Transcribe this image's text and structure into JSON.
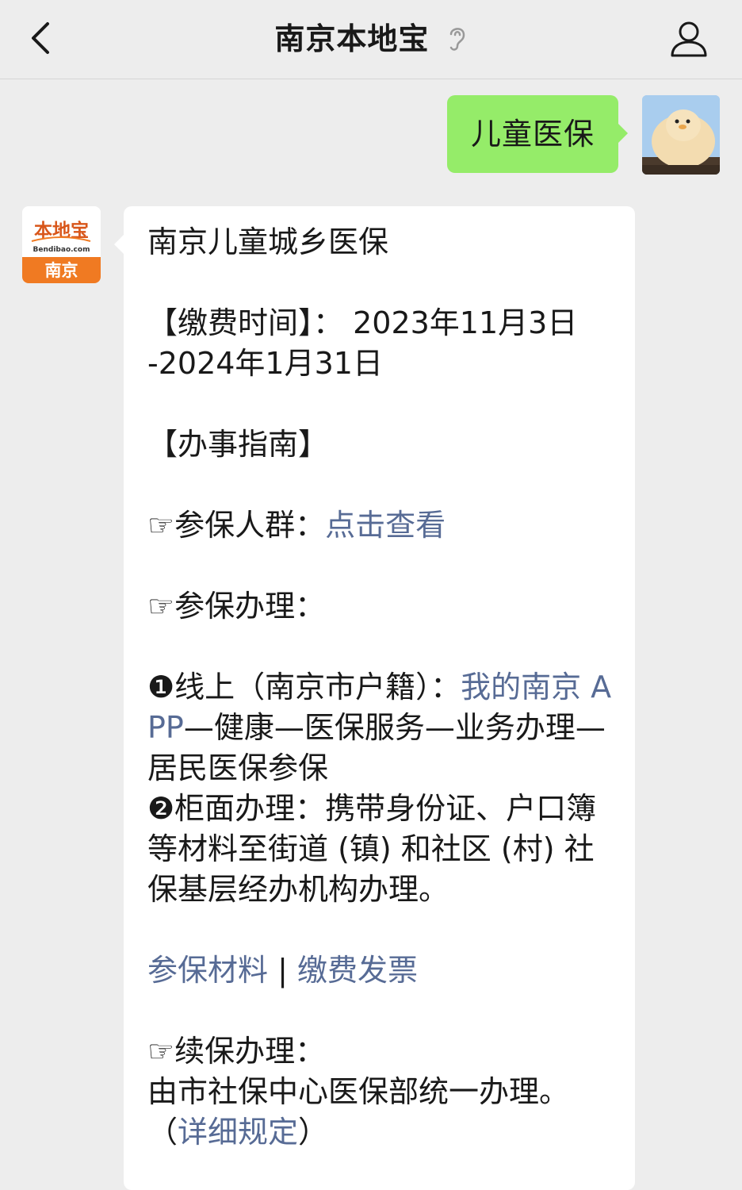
{
  "header": {
    "title": "南京本地宝",
    "back_icon": "chevron-left-icon",
    "ear_icon": "ear-icon",
    "profile_icon": "user-icon"
  },
  "outgoing_message": {
    "text": "儿童医保"
  },
  "incoming_avatar": {
    "logo_top": "本地宝",
    "logo_domain": "Bendibao.com",
    "logo_city": "南京"
  },
  "incoming_message": {
    "title": "南京儿童城乡医保",
    "fee_time_label": "【缴费时间】：",
    "fee_time_value_1": " 2023年11月3日",
    "fee_time_value_2": "-2024年1月31日",
    "guide_heading": "【办事指南】",
    "insured_group_label": "☞参保人群：",
    "insured_group_link": "点击查看",
    "enroll_label": "☞参保办理：",
    "online_prefix": "❶线上（南京市户籍）：",
    "online_link": "我的南京 APP",
    "online_path": "—健康—医保服务—业务办理—居民医保参保",
    "counter_text": "❷柜面办理：携带身份证、户口簿等材料至街道 (镇) 和社区 (村) 社保基层经办机构办理。",
    "materials_link": "参保材料",
    "separator": " | ",
    "invoice_link": "缴费发票",
    "renew_label": "☞续保办理：",
    "renew_text": "由市社保中心医保部统一办理。",
    "renew_paren_open": "（",
    "renew_detail_link": "详细规定",
    "renew_paren_close": "）"
  },
  "colors": {
    "background": "#ededed",
    "outgoing_bubble": "#95ec69",
    "incoming_bubble": "#ffffff",
    "link": "#576b95",
    "logo_orange": "#f07a22"
  }
}
